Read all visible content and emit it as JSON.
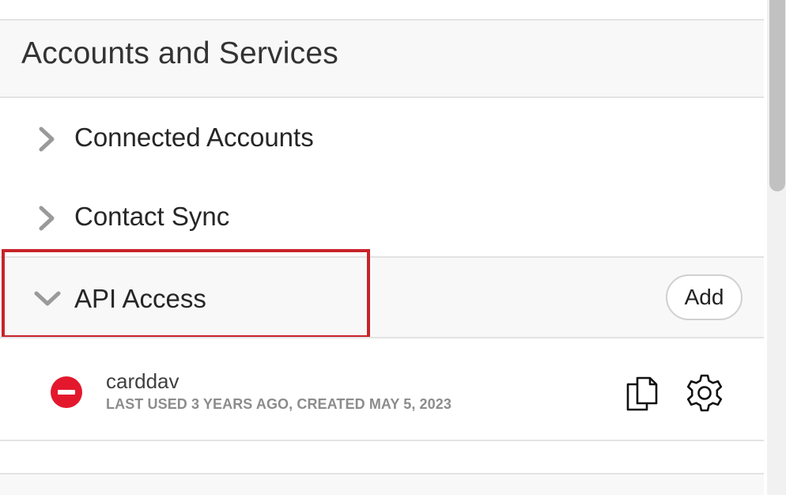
{
  "section": {
    "title": "Accounts and Services"
  },
  "rows": {
    "connected_accounts": "Connected Accounts",
    "contact_sync": "Contact Sync",
    "api_access": "API Access"
  },
  "api_access": {
    "add_label": "Add",
    "items": [
      {
        "name": "carddav",
        "meta": "LAST USED 3 YEARS AGO, CREATED MAY 5, 2023"
      }
    ]
  },
  "icons": {
    "collapsed": "chevron-right-icon",
    "expanded": "chevron-down-icon",
    "remove": "remove-icon",
    "copy": "copy-icon",
    "settings": "gear-icon"
  },
  "colors": {
    "highlight": "#c8232a",
    "remove": "#e3182d",
    "chevron": "#9a9a9a"
  }
}
